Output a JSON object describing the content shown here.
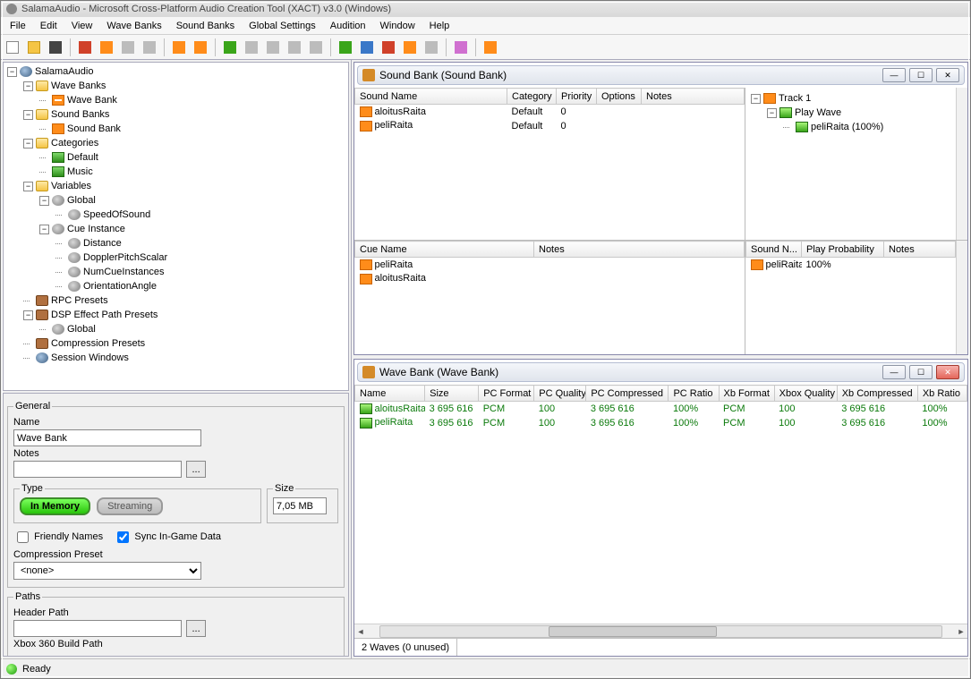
{
  "title": "SalamaAudio - Microsoft Cross-Platform Audio Creation Tool (XACT) v3.0 (Windows)",
  "menu": [
    "File",
    "Edit",
    "View",
    "Wave Banks",
    "Sound Banks",
    "Global Settings",
    "Audition",
    "Window",
    "Help"
  ],
  "toolbar_icons": [
    "new",
    "open",
    "save",
    "|",
    "delete",
    "refresh",
    "clone",
    "align",
    "|",
    "mail",
    "mail-open",
    "|",
    "add",
    "rect",
    "rect",
    "rect",
    "rect",
    "|",
    "play",
    "pause-blue",
    "stop-red",
    "alert",
    "gray",
    "|",
    "link",
    "|",
    "grid-or"
  ],
  "tree": {
    "root": "SalamaAudio",
    "nodes": {
      "waveBanks": "Wave Banks",
      "waveBank": "Wave Bank",
      "soundBanks": "Sound Banks",
      "soundBank": "Sound Bank",
      "categories": "Categories",
      "catDefault": "Default",
      "catMusic": "Music",
      "variables": "Variables",
      "global": "Global",
      "speed": "SpeedOfSound",
      "cueInst": "Cue Instance",
      "distance": "Distance",
      "doppler": "DopplerPitchScalar",
      "numcue": "NumCueInstances",
      "orient": "OrientationAngle",
      "rpc": "RPC Presets",
      "dsp": "DSP Effect Path Presets",
      "dspGlobal": "Global",
      "comp": "Compression Presets",
      "sess": "Session Windows"
    }
  },
  "props": {
    "generalLegend": "General",
    "nameLabel": "Name",
    "nameValue": "Wave Bank",
    "notesLabel": "Notes",
    "notesValue": "",
    "typeLegend": "Type",
    "inMemory": "In Memory",
    "streaming": "Streaming",
    "sizeLegend": "Size",
    "sizeValue": "7,05 MB",
    "friendly": "Friendly Names",
    "sync": "Sync In-Game Data",
    "compPresetLabel": "Compression Preset",
    "compPresetValue": "<none>",
    "pathsLegend": "Paths",
    "headerPath": "Header Path",
    "xboxPath": "Xbox 360 Build Path"
  },
  "soundBankWin": {
    "title": "Sound Bank (Sound Bank)",
    "soundCols": [
      "Sound Name",
      "Category",
      "Priority",
      "Options",
      "Notes"
    ],
    "soundRows": [
      {
        "name": "aloitusRaita",
        "cat": "Default",
        "pri": "0",
        "opt": "",
        "notes": ""
      },
      {
        "name": "peliRaita",
        "cat": "Default",
        "pri": "0",
        "opt": "",
        "notes": ""
      }
    ],
    "trackTree": {
      "track": "Track 1",
      "playWave": "Play Wave",
      "item": "peliRaita (100%)"
    },
    "cueCols": [
      "Cue Name",
      "Notes"
    ],
    "cueRows": [
      {
        "name": "peliRaita",
        "notes": ""
      },
      {
        "name": "aloitusRaita",
        "notes": ""
      }
    ],
    "cueRightCols": [
      "Sound N...",
      "Play Probability",
      "Notes"
    ],
    "cueRightRows": [
      {
        "name": "peliRaita",
        "prob": "100%",
        "notes": ""
      }
    ]
  },
  "waveBankWin": {
    "title": "Wave Bank (Wave Bank)",
    "cols": [
      "Name",
      "Size",
      "PC Format",
      "PC Quality",
      "PC Compressed",
      "PC Ratio",
      "Xb Format",
      "Xbox Quality",
      "Xb Compressed",
      "Xb Ratio"
    ],
    "rows": [
      {
        "name": "aloitusRaita",
        "size": "3 695 616",
        "pcf": "PCM",
        "pcq": "100",
        "pcc": "3 695 616",
        "pcr": "100%",
        "xbf": "PCM",
        "xbq": "100",
        "xbc": "3 695 616",
        "xbr": "100%"
      },
      {
        "name": "peliRaita",
        "size": "3 695 616",
        "pcf": "PCM",
        "pcq": "100",
        "pcc": "3 695 616",
        "pcr": "100%",
        "xbf": "PCM",
        "xbq": "100",
        "xbc": "3 695 616",
        "xbr": "100%"
      }
    ],
    "status": "2 Waves (0 unused)"
  },
  "status": "Ready"
}
